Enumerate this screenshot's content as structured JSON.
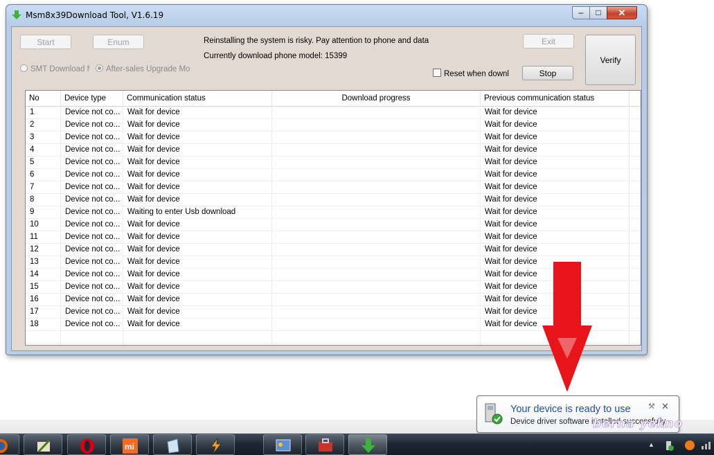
{
  "window": {
    "title": "Msm8x39Download Tool, V1.6.19"
  },
  "toolbar": {
    "start_label": "Start",
    "enum_label": "Enum",
    "exit_label": "Exit",
    "stop_label": "Stop",
    "verify_label": "Verify",
    "warning_text": "Reinstalling the system is risky. Pay attention to phone and data",
    "model_text": "Currently download phone model: 15399",
    "radio_smt": "SMT Download Mo",
    "radio_aftersales": "After-sales Upgrade Moc",
    "reset_checkbox": "Reset when downlo"
  },
  "table": {
    "columns": [
      "No",
      "Device type",
      "Communication status",
      "Download progress",
      "Previous communication status"
    ],
    "rows": [
      {
        "no": "1",
        "type": "Device not co...",
        "comm": "Wait for device",
        "progress": "",
        "prev": "Wait for device"
      },
      {
        "no": "2",
        "type": "Device not co...",
        "comm": "Wait for device",
        "progress": "",
        "prev": "Wait for device"
      },
      {
        "no": "3",
        "type": "Device not co...",
        "comm": "Wait for device",
        "progress": "",
        "prev": "Wait for device"
      },
      {
        "no": "4",
        "type": "Device not co...",
        "comm": "Wait for device",
        "progress": "",
        "prev": "Wait for device"
      },
      {
        "no": "5",
        "type": "Device not co...",
        "comm": "Wait for device",
        "progress": "",
        "prev": "Wait for device"
      },
      {
        "no": "6",
        "type": "Device not co...",
        "comm": "Wait for device",
        "progress": "",
        "prev": "Wait for device"
      },
      {
        "no": "7",
        "type": "Device not co...",
        "comm": "Wait for device",
        "progress": "",
        "prev": "Wait for device"
      },
      {
        "no": "8",
        "type": "Device not co...",
        "comm": "Wait for device",
        "progress": "",
        "prev": "Wait for device"
      },
      {
        "no": "9",
        "type": "Device not co...",
        "comm": "Waiting to enter Usb download",
        "progress": "",
        "prev": "Wait for device"
      },
      {
        "no": "10",
        "type": "Device not co...",
        "comm": "Wait for device",
        "progress": "",
        "prev": "Wait for device"
      },
      {
        "no": "11",
        "type": "Device not co...",
        "comm": "Wait for device",
        "progress": "",
        "prev": "Wait for device"
      },
      {
        "no": "12",
        "type": "Device not co...",
        "comm": "Wait for device",
        "progress": "",
        "prev": "Wait for device"
      },
      {
        "no": "13",
        "type": "Device not co...",
        "comm": "Wait for device",
        "progress": "",
        "prev": "Wait for device"
      },
      {
        "no": "14",
        "type": "Device not co...",
        "comm": "Wait for device",
        "progress": "",
        "prev": "Wait for device"
      },
      {
        "no": "15",
        "type": "Device not co...",
        "comm": "Wait for device",
        "progress": "",
        "prev": "Wait for device"
      },
      {
        "no": "16",
        "type": "Device not co...",
        "comm": "Wait for device",
        "progress": "",
        "prev": "Wait for device"
      },
      {
        "no": "17",
        "type": "Device not co...",
        "comm": "Wait for device",
        "progress": "",
        "prev": "Wait for device"
      },
      {
        "no": "18",
        "type": "Device not co...",
        "comm": "Wait for device",
        "progress": "",
        "prev": "Wait for device"
      },
      {
        "no": "",
        "type": "",
        "comm": "",
        "progress": "",
        "prev": ""
      },
      {
        "no": "",
        "type": "",
        "comm": "",
        "progress": "",
        "prev": ""
      }
    ]
  },
  "notification": {
    "title": "Your device is ready to use",
    "subtitle": "Device driver software installed successfully."
  },
  "watermark": "berna yekno",
  "taskbar": {
    "items": [
      "firefox-icon",
      "paint-brush-icon",
      "opera-icon",
      "mi-icon",
      "notepad-icon",
      "winamp-icon",
      "desktop-app-icon",
      "toolbox-icon",
      "download-tool-icon"
    ]
  },
  "colors": {
    "arrow": "#e8141a",
    "window_frame": "#b9cfe9",
    "client_bg": "#e2d9d3",
    "notification_title": "#1e4fa0"
  }
}
